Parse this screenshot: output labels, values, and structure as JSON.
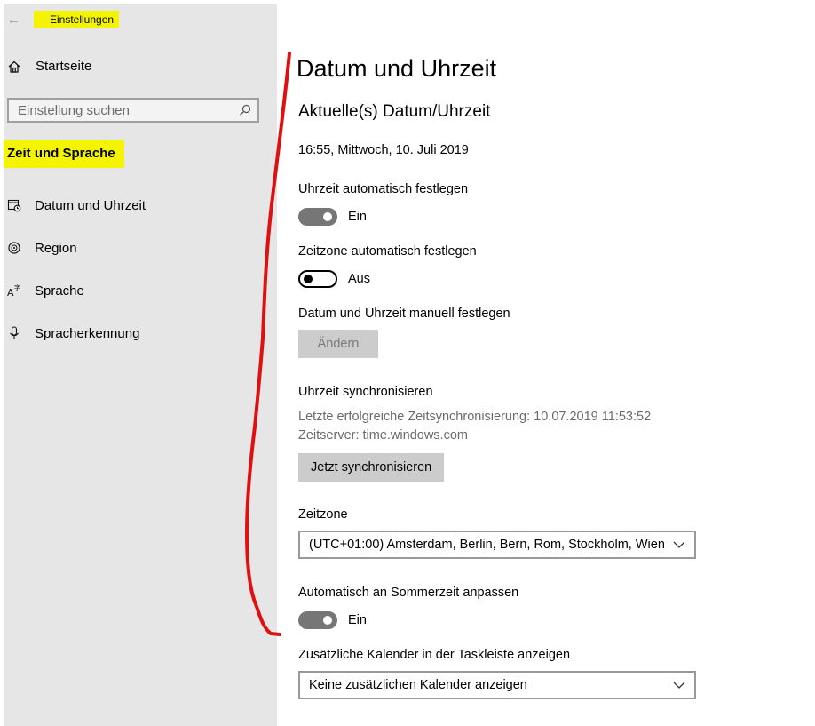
{
  "window": {
    "title": "Einstellungen"
  },
  "sidebar": {
    "home_label": "Startseite",
    "search_placeholder": "Einstellung suchen",
    "section_title": "Zeit und Sprache",
    "items": [
      {
        "label": "Datum und Uhrzeit",
        "icon": "calendar-clock-icon"
      },
      {
        "label": "Region",
        "icon": "globe-icon"
      },
      {
        "label": "Sprache",
        "icon": "language-icon"
      },
      {
        "label": "Spracherkennung",
        "icon": "microphone-icon"
      }
    ]
  },
  "main": {
    "page_title": "Datum und Uhrzeit",
    "current_heading": "Aktuelle(s) Datum/Uhrzeit",
    "current_value": "16:55, Mittwoch, 10. Juli 2019",
    "auto_time": {
      "label": "Uhrzeit automatisch festlegen",
      "state": "Ein",
      "on": true
    },
    "auto_timezone": {
      "label": "Zeitzone automatisch festlegen",
      "state": "Aus",
      "on": false
    },
    "manual": {
      "label": "Datum und Uhrzeit manuell festlegen",
      "button": "Ändern"
    },
    "sync": {
      "heading": "Uhrzeit synchronisieren",
      "last_sync": "Letzte erfolgreiche Zeitsynchronisierung: 10.07.2019 11:53:52",
      "server": "Zeitserver: time.windows.com",
      "button": "Jetzt synchronisieren"
    },
    "timezone": {
      "label": "Zeitzone",
      "value": "(UTC+01:00) Amsterdam, Berlin, Bern, Rom, Stockholm, Wien"
    },
    "dst": {
      "label": "Automatisch an Sommerzeit anpassen",
      "state": "Ein",
      "on": true
    },
    "calendar": {
      "label": "Zusätzliche Kalender in der Taskleiste anzeigen",
      "value": "Keine zusätzlichen Kalender anzeigen"
    }
  },
  "colors": {
    "sidebar_bg": "#e6e6e6",
    "highlight": "#f4f400",
    "toggle_on": "#767676",
    "annotation_red": "#e01010",
    "button_bg": "#cccccc"
  }
}
